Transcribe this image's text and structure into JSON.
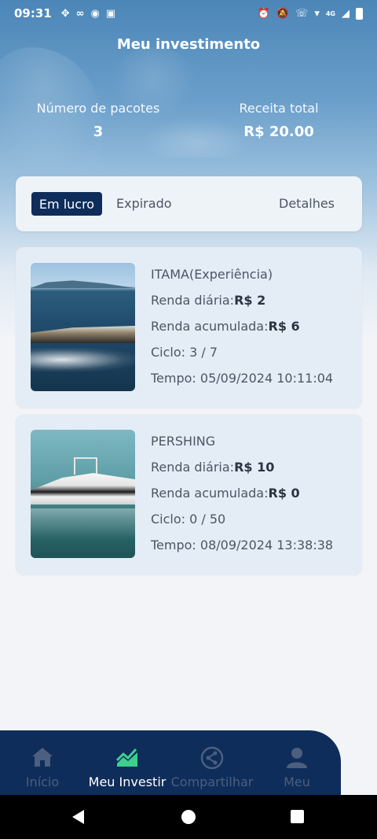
{
  "status_bar": {
    "time": "09:31",
    "network": "4G"
  },
  "header": {
    "title": "Meu investimento",
    "stats": [
      {
        "label": "Número de pacotes",
        "value": "3"
      },
      {
        "label": "Receita total",
        "value": "R$ 20.00"
      }
    ]
  },
  "tabs": {
    "active": "Em lucro",
    "expired": "Expirado",
    "details": "Detalhes"
  },
  "investments": [
    {
      "name": "ITAMA(Experiência)",
      "daily_label": "Renda diária:",
      "daily_value": "R$ 2",
      "accum_label": "Renda acumulada:",
      "accum_value": "R$ 6",
      "cycle": "Ciclo: 3 / 7",
      "time": "Tempo: 05/09/2024 10:11:04"
    },
    {
      "name": "PERSHING",
      "daily_label": "Renda diária:",
      "daily_value": "R$ 10",
      "accum_label": "Renda acumulada:",
      "accum_value": "R$ 0",
      "cycle": "Ciclo: 0 / 50",
      "time": "Tempo: 08/09/2024 13:38:38"
    }
  ],
  "bottom_nav": [
    {
      "label": "Início",
      "icon": "home-icon"
    },
    {
      "label": "Meu Investir",
      "icon": "chart-icon",
      "active": true
    },
    {
      "label": "Compartilhar",
      "icon": "share-icon"
    },
    {
      "label": "Meu",
      "icon": "user-icon"
    }
  ],
  "colors": {
    "primary": "#0e2d5a",
    "card_bg": "#e4edf6",
    "active_icon": "#3ecf8e"
  }
}
